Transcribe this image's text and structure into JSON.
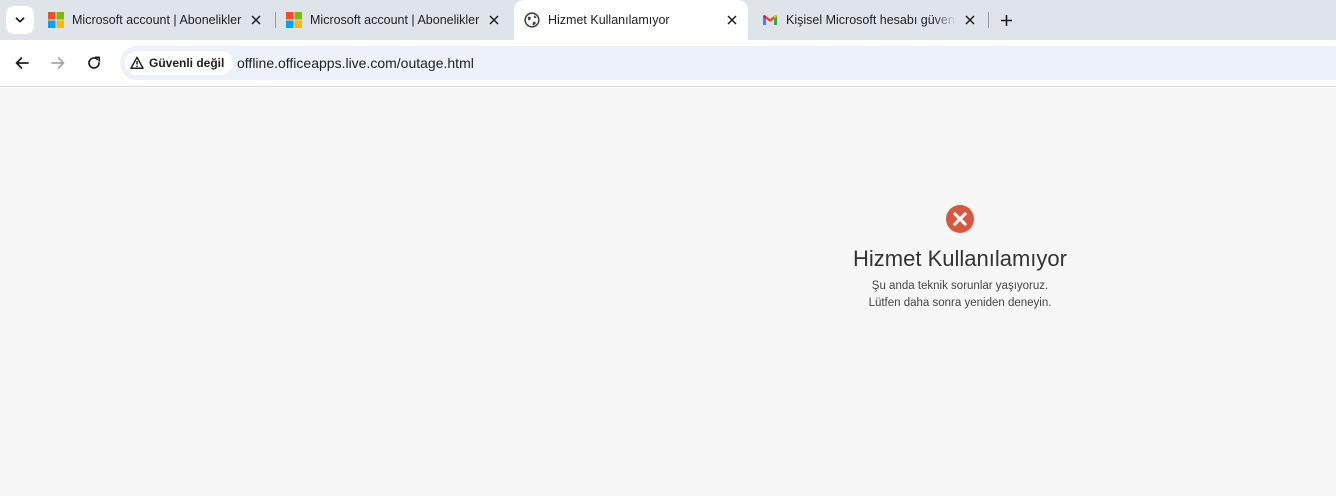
{
  "tabs": [
    {
      "title": "Microsoft account | Abonelikler",
      "favicon": "microsoft-logo-icon",
      "active": false
    },
    {
      "title": "Microsoft account | Abonelikler",
      "favicon": "microsoft-logo-icon",
      "active": false
    },
    {
      "title": "Hizmet Kullanılamıyor",
      "favicon": "globe-icon",
      "active": true
    },
    {
      "title": "Kişisel Microsoft hesabı güvenli",
      "favicon": "gmail-icon",
      "active": false
    }
  ],
  "toolbar": {
    "security_label": "Güvenli değil",
    "url": "offline.officeapps.live.com/outage.html"
  },
  "page": {
    "title": "Hizmet Kullanılamıyor",
    "line1": "Şu anda teknik sorunlar yaşıyoruz.",
    "line2": "Lütfen daha sonra yeniden deneyin."
  },
  "colors": {
    "error_red": "#d9573f",
    "tabstrip_bg": "#dfe3ea",
    "omnibox_bg": "#edf2fa",
    "page_bg": "#f7f7f7"
  }
}
